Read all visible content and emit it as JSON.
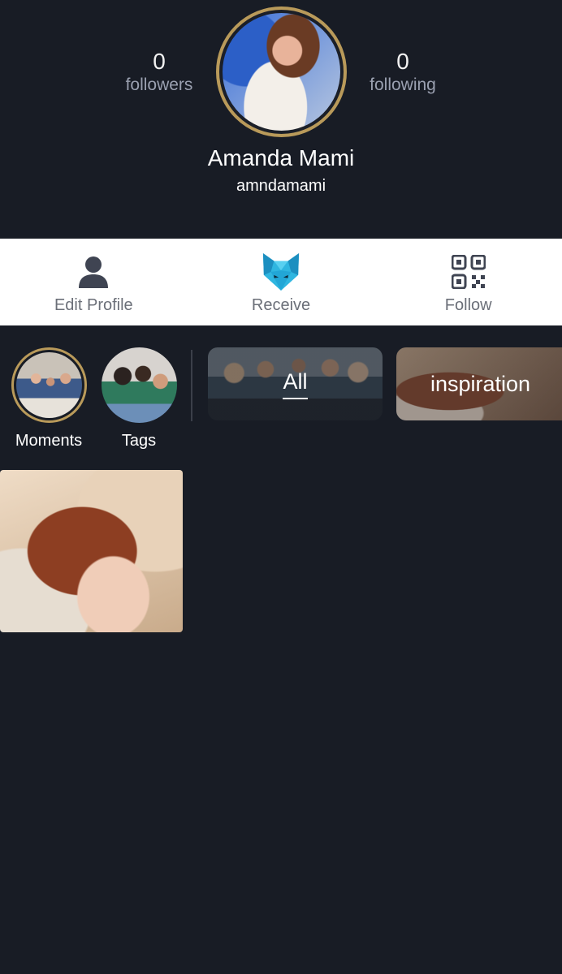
{
  "profile": {
    "followers_count": "0",
    "followers_label": "followers",
    "following_count": "0",
    "following_label": "following",
    "name": "Amanda Mami",
    "handle": "amndamami"
  },
  "actions": {
    "edit_profile": "Edit Profile",
    "receive": "Receive",
    "follow": "Follow"
  },
  "stories": {
    "moments": "Moments",
    "tags": "Tags"
  },
  "categories": [
    {
      "label": "All",
      "selected": true
    },
    {
      "label": "inspiration",
      "selected": false
    }
  ],
  "colors": {
    "background": "#181c25",
    "avatar_ring": "#b99a5a",
    "action_bar": "#ffffff",
    "action_text": "#6b6f78",
    "muted_text": "#9aa0b0",
    "receive_icon": "#2fb6e0"
  },
  "icons": {
    "edit_profile": "person-icon",
    "receive": "fox-logo-icon",
    "follow": "qr-code-icon"
  }
}
